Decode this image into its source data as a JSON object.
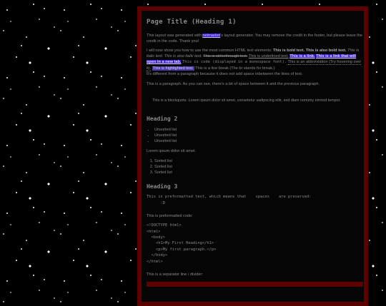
{
  "title": "Page Title (Heading 1)",
  "intro": {
    "part1": "This layout was generated with ",
    "credit_link": "netmarket",
    "part2": "'s layout generator. You may remove the credit in the footer, but please leave the credit in the code. Thank you!"
  },
  "elements": {
    "lead": "I will now show you how to use the most common HTML text elements: ",
    "bold1": "This is bold text.",
    "bold2": "This is also bold text.",
    "italic1": "This is italic text.",
    "italic2": "This is also italic text.",
    "strike": "This is strikethrough text.",
    "underline": "This is underlined text.",
    "link1": "This is a link.",
    "link2": "This is a link that will open in a new tab.",
    "code": "This is code (displayed in a monospace font).",
    "abbr": "This is an abbreviation (Try hovering over it).",
    "highlight": "This is highlighted text.",
    "line_break1": "This is a line break (The br stands for break.)",
    "line_break2": "It's different from a paragraph because it does not add space inbetween the lines of text."
  },
  "paragraph": "This is a paragraph. As you can see, there's a bit of space between it and the previous paragraph.",
  "blockquote": "This is a blockquote. Lorem ipsum dolor sit amet, consetetur sadipscing elitr, sed diam nonumy eirmod tempor.",
  "h2": "Heading 2",
  "unsorted": [
    "Unsorted list",
    "Unsorted list",
    "Unsorted list"
  ],
  "lorem": "Lorem ipsum dolor sit amet.",
  "sorted": [
    "Sorted list",
    "Sorted list",
    "Sorted list"
  ],
  "h3": "Heading 3",
  "preformatted": "This is preformatted text, which means that    spaces    are preserved:\n      :D",
  "preformatted_code_label": "This is preformatted code:",
  "code_block": "<!DOCTYPE html>\n<html>\n  <body>\n    <h1>My First Heading</h1>\n    <p>My first paragraph.</p>\n  </body>\n</html>",
  "separator_label": "This is a separator line / divider:",
  "colors": {
    "frame": "#5c0000",
    "link_bg": "#3a1bd6",
    "text": "#8a8a8a"
  }
}
